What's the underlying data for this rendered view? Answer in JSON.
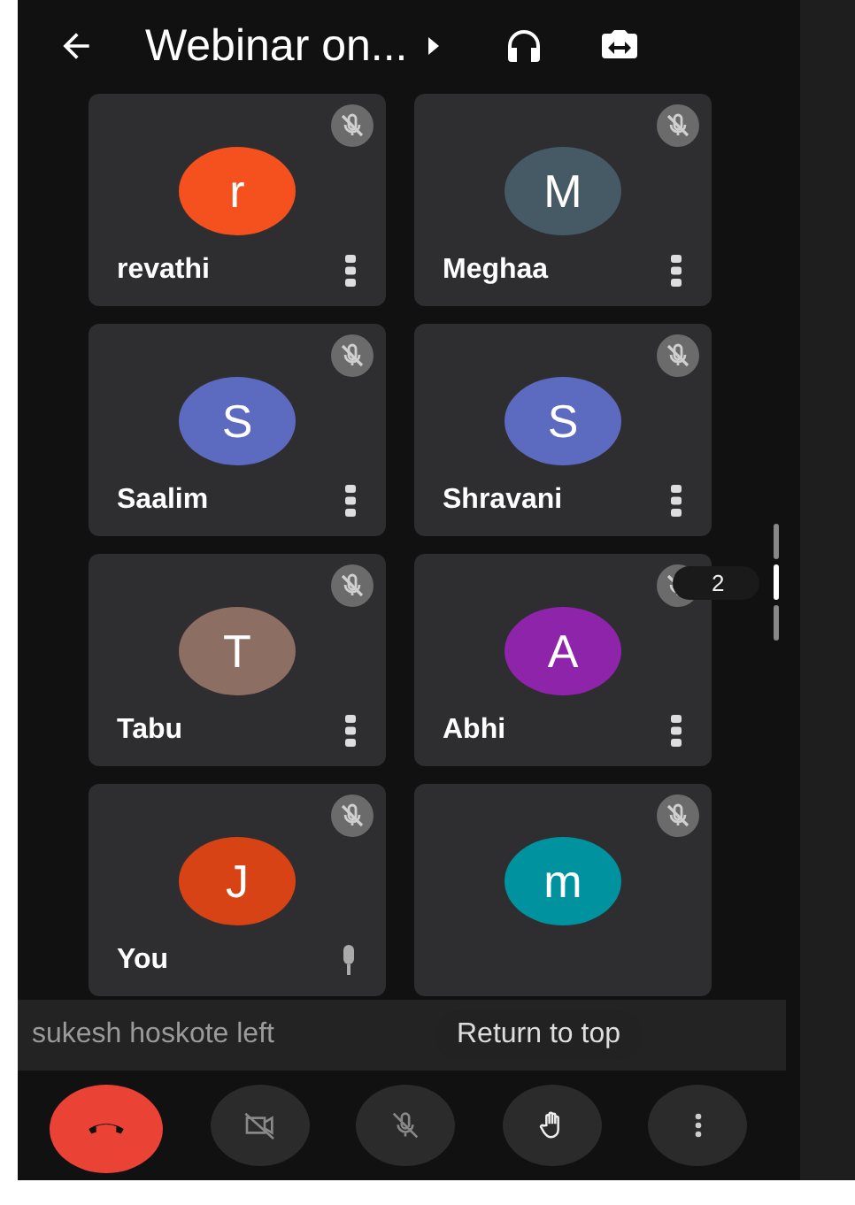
{
  "header": {
    "title": "Webinar on..."
  },
  "tiles": [
    {
      "name": "revathi",
      "initial": "r",
      "color": "#f4511e",
      "muted": true,
      "kind": "more"
    },
    {
      "name": "Meghaa",
      "initial": "M",
      "color": "#455a64",
      "muted": true,
      "kind": "more"
    },
    {
      "name": "Saalim",
      "initial": "S",
      "color": "#5c6bc0",
      "muted": true,
      "kind": "more"
    },
    {
      "name": "Shravani",
      "initial": "S",
      "color": "#5c6bc0",
      "muted": true,
      "kind": "more"
    },
    {
      "name": "Tabu",
      "initial": "T",
      "color": "#8d6e63",
      "muted": true,
      "kind": "more"
    },
    {
      "name": "Abhi",
      "initial": "A",
      "color": "#8e24aa",
      "muted": true,
      "kind": "more"
    },
    {
      "name": "You",
      "initial": "J",
      "color": "#d84315",
      "muted": true,
      "kind": "mic"
    },
    {
      "initial": "m",
      "color": "#00939f",
      "muted": true,
      "kind": "none"
    }
  ],
  "toast": "sukesh hoskote left",
  "return_button": "Return to top",
  "page_indicator": "2",
  "controls": [
    {
      "kind": "end_call"
    },
    {
      "kind": "camera_off"
    },
    {
      "kind": "mic_off"
    },
    {
      "kind": "raise_hand"
    },
    {
      "kind": "more"
    }
  ]
}
